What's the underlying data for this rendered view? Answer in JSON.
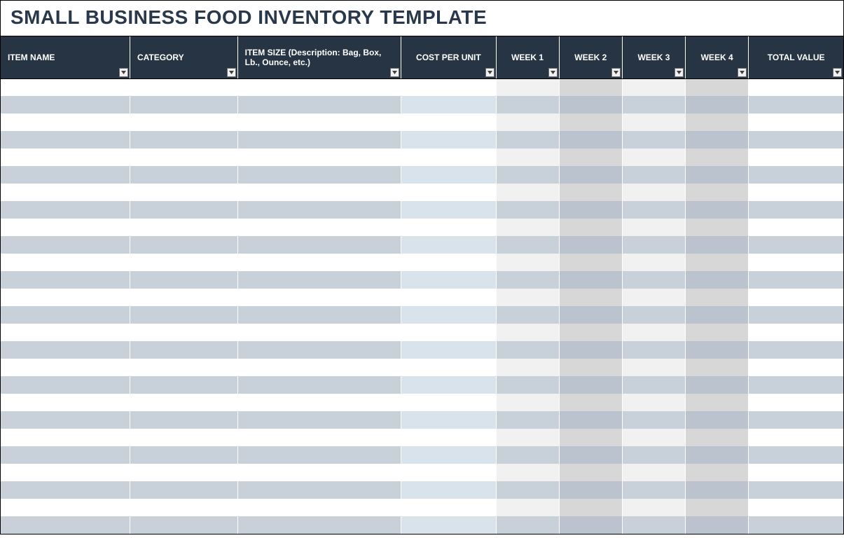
{
  "title": "SMALL BUSINESS FOOD INVENTORY  TEMPLATE",
  "columns": {
    "item_name": "ITEM NAME",
    "category": "CATEGORY",
    "item_size": "ITEM SIZE (Description: Bag, Box, Lb., Ounce, etc.)",
    "cost_per_unit": "COST PER UNIT",
    "week1": "WEEK 1",
    "week2": "WEEK 2",
    "week3": "WEEK 3",
    "week4": "WEEK 4",
    "total_value": "TOTAL VALUE"
  },
  "rows": [
    {
      "item_name": "",
      "category": "",
      "item_size": "",
      "cost_per_unit": "",
      "week1": "",
      "week2": "",
      "week3": "",
      "week4": "",
      "total_value": ""
    },
    {
      "item_name": "",
      "category": "",
      "item_size": "",
      "cost_per_unit": "",
      "week1": "",
      "week2": "",
      "week3": "",
      "week4": "",
      "total_value": ""
    },
    {
      "item_name": "",
      "category": "",
      "item_size": "",
      "cost_per_unit": "",
      "week1": "",
      "week2": "",
      "week3": "",
      "week4": "",
      "total_value": ""
    },
    {
      "item_name": "",
      "category": "",
      "item_size": "",
      "cost_per_unit": "",
      "week1": "",
      "week2": "",
      "week3": "",
      "week4": "",
      "total_value": ""
    },
    {
      "item_name": "",
      "category": "",
      "item_size": "",
      "cost_per_unit": "",
      "week1": "",
      "week2": "",
      "week3": "",
      "week4": "",
      "total_value": ""
    },
    {
      "item_name": "",
      "category": "",
      "item_size": "",
      "cost_per_unit": "",
      "week1": "",
      "week2": "",
      "week3": "",
      "week4": "",
      "total_value": ""
    },
    {
      "item_name": "",
      "category": "",
      "item_size": "",
      "cost_per_unit": "",
      "week1": "",
      "week2": "",
      "week3": "",
      "week4": "",
      "total_value": ""
    },
    {
      "item_name": "",
      "category": "",
      "item_size": "",
      "cost_per_unit": "",
      "week1": "",
      "week2": "",
      "week3": "",
      "week4": "",
      "total_value": ""
    },
    {
      "item_name": "",
      "category": "",
      "item_size": "",
      "cost_per_unit": "",
      "week1": "",
      "week2": "",
      "week3": "",
      "week4": "",
      "total_value": ""
    },
    {
      "item_name": "",
      "category": "",
      "item_size": "",
      "cost_per_unit": "",
      "week1": "",
      "week2": "",
      "week3": "",
      "week4": "",
      "total_value": ""
    },
    {
      "item_name": "",
      "category": "",
      "item_size": "",
      "cost_per_unit": "",
      "week1": "",
      "week2": "",
      "week3": "",
      "week4": "",
      "total_value": ""
    },
    {
      "item_name": "",
      "category": "",
      "item_size": "",
      "cost_per_unit": "",
      "week1": "",
      "week2": "",
      "week3": "",
      "week4": "",
      "total_value": ""
    },
    {
      "item_name": "",
      "category": "",
      "item_size": "",
      "cost_per_unit": "",
      "week1": "",
      "week2": "",
      "week3": "",
      "week4": "",
      "total_value": ""
    },
    {
      "item_name": "",
      "category": "",
      "item_size": "",
      "cost_per_unit": "",
      "week1": "",
      "week2": "",
      "week3": "",
      "week4": "",
      "total_value": ""
    },
    {
      "item_name": "",
      "category": "",
      "item_size": "",
      "cost_per_unit": "",
      "week1": "",
      "week2": "",
      "week3": "",
      "week4": "",
      "total_value": ""
    },
    {
      "item_name": "",
      "category": "",
      "item_size": "",
      "cost_per_unit": "",
      "week1": "",
      "week2": "",
      "week3": "",
      "week4": "",
      "total_value": ""
    },
    {
      "item_name": "",
      "category": "",
      "item_size": "",
      "cost_per_unit": "",
      "week1": "",
      "week2": "",
      "week3": "",
      "week4": "",
      "total_value": ""
    },
    {
      "item_name": "",
      "category": "",
      "item_size": "",
      "cost_per_unit": "",
      "week1": "",
      "week2": "",
      "week3": "",
      "week4": "",
      "total_value": ""
    },
    {
      "item_name": "",
      "category": "",
      "item_size": "",
      "cost_per_unit": "",
      "week1": "",
      "week2": "",
      "week3": "",
      "week4": "",
      "total_value": ""
    },
    {
      "item_name": "",
      "category": "",
      "item_size": "",
      "cost_per_unit": "",
      "week1": "",
      "week2": "",
      "week3": "",
      "week4": "",
      "total_value": ""
    },
    {
      "item_name": "",
      "category": "",
      "item_size": "",
      "cost_per_unit": "",
      "week1": "",
      "week2": "",
      "week3": "",
      "week4": "",
      "total_value": ""
    },
    {
      "item_name": "",
      "category": "",
      "item_size": "",
      "cost_per_unit": "",
      "week1": "",
      "week2": "",
      "week3": "",
      "week4": "",
      "total_value": ""
    },
    {
      "item_name": "",
      "category": "",
      "item_size": "",
      "cost_per_unit": "",
      "week1": "",
      "week2": "",
      "week3": "",
      "week4": "",
      "total_value": ""
    },
    {
      "item_name": "",
      "category": "",
      "item_size": "",
      "cost_per_unit": "",
      "week1": "",
      "week2": "",
      "week3": "",
      "week4": "",
      "total_value": ""
    },
    {
      "item_name": "",
      "category": "",
      "item_size": "",
      "cost_per_unit": "",
      "week1": "",
      "week2": "",
      "week3": "",
      "week4": "",
      "total_value": ""
    },
    {
      "item_name": "",
      "category": "",
      "item_size": "",
      "cost_per_unit": "",
      "week1": "",
      "week2": "",
      "week3": "",
      "week4": "",
      "total_value": ""
    }
  ]
}
